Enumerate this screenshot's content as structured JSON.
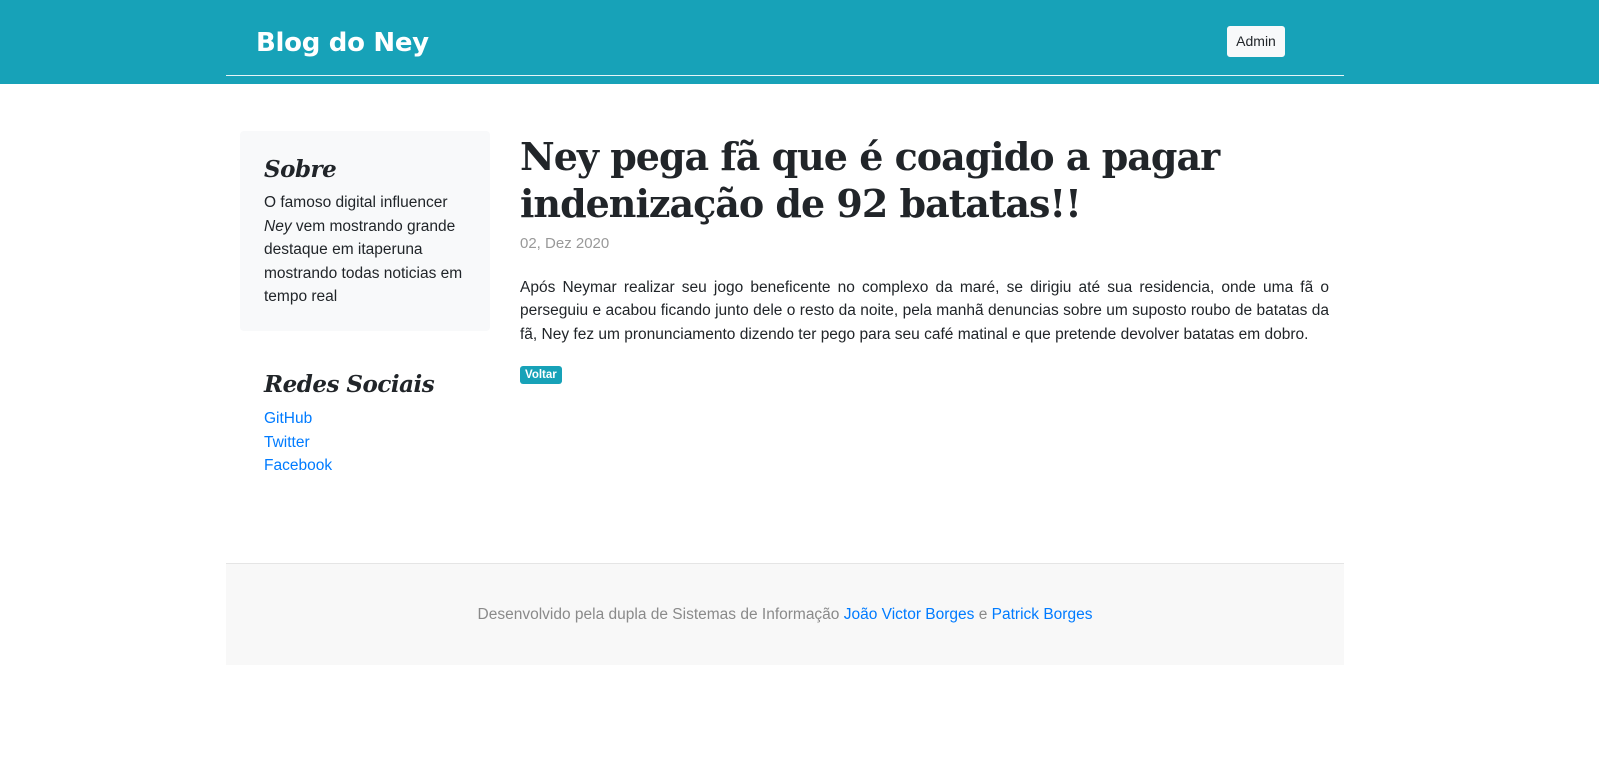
{
  "header": {
    "brand": "Blog do Ney",
    "admin_label": "Admin"
  },
  "sidebar": {
    "about": {
      "title": "Sobre",
      "text_part1": "O famoso digital influencer ",
      "text_emphasis": "Ney",
      "text_part2": " vem mostrando grande destaque em itaperuna mostrando todas noticias em tempo real"
    },
    "social": {
      "title": "Redes Sociais",
      "links": [
        "GitHub",
        "Twitter",
        "Facebook"
      ]
    }
  },
  "post": {
    "title": "Ney pega fã que é coagido a pagar indenização de 92 batatas!!",
    "date": "02, Dez 2020",
    "body": "Após Neymar realizar seu jogo beneficente no complexo da maré, se dirigiu até sua residencia, onde uma fã o perseguiu e acabou ficando junto dele o resto da noite, pela manhã denuncias sobre um suposto roubo de batatas da fã, Ney fez um pronunciamento dizendo ter pego para seu café matinal e que pretende devolver batatas em dobro.",
    "back_label": "Voltar"
  },
  "footer": {
    "text": "Desenvolvido pela dupla de Sistemas de Informação ",
    "author1": "João Victor Borges",
    "connector": " e ",
    "author2": "Patrick Borges"
  },
  "colors": {
    "accent": "#17a2b8",
    "link": "#007bff",
    "sidebar_bg": "#f8f9fa",
    "footer_bg": "#f8f8f8"
  }
}
